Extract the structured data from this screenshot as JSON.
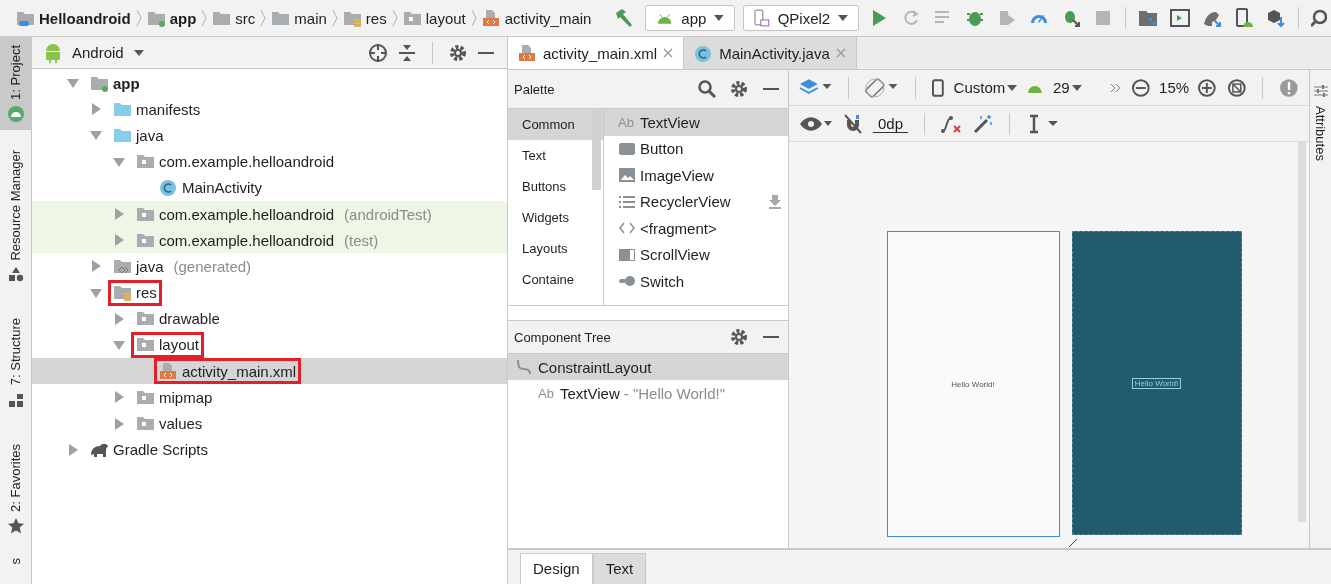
{
  "breadcrumb": [
    {
      "label": "Helloandroid",
      "kind": "project"
    },
    {
      "label": "app",
      "kind": "module"
    },
    {
      "label": "src",
      "kind": "folder"
    },
    {
      "label": "main",
      "kind": "folder"
    },
    {
      "label": "res",
      "kind": "res"
    },
    {
      "label": "layout",
      "kind": "package"
    },
    {
      "label": "activity_main",
      "kind": "xml"
    }
  ],
  "run_config": {
    "label": "app"
  },
  "device": {
    "label": "QPixel2"
  },
  "toolbar": [
    {
      "kind": "run",
      "disabled": false
    },
    {
      "kind": "apply-changes",
      "disabled": true
    },
    {
      "kind": "apply-code",
      "disabled": true
    },
    {
      "kind": "debug",
      "disabled": false
    },
    {
      "kind": "profile-run",
      "disabled": true
    },
    {
      "kind": "profiler",
      "disabled": false
    },
    {
      "kind": "attach",
      "disabled": false
    },
    {
      "kind": "stop",
      "disabled": true
    }
  ],
  "left_tabs": [
    {
      "label": "1: Project",
      "selected": true,
      "kind": "android"
    },
    {
      "label": "Resource Manager",
      "selected": false,
      "kind": "shapes"
    },
    {
      "label": "7: Structure",
      "selected": false,
      "kind": "structure"
    },
    {
      "label": "2: Favorites",
      "selected": false,
      "kind": "star"
    },
    {
      "label": "s",
      "selected": false,
      "kind": "none"
    }
  ],
  "project": {
    "view": "Android",
    "tree": [
      {
        "label": "app",
        "kind": "module",
        "expanded": true,
        "selected": false,
        "children": [
          {
            "label": "manifests",
            "kind": "src-folder",
            "expanded": false,
            "selected": false
          },
          {
            "label": "java",
            "kind": "src-folder",
            "expanded": true,
            "selected": false,
            "children": [
              {
                "label": "com.example.helloandroid",
                "kind": "package",
                "expanded": true,
                "selected": false,
                "children": [
                  {
                    "label": "MainActivity",
                    "kind": "class",
                    "selected": false
                  }
                ]
              },
              {
                "label": "com.example.helloandroid",
                "suffix": "(androidTest)",
                "kind": "package",
                "expanded": false,
                "selected": false,
                "tinted": true
              },
              {
                "label": "com.example.helloandroid",
                "suffix": "(test)",
                "kind": "package",
                "expanded": false,
                "selected": false,
                "tinted": true
              }
            ]
          },
          {
            "label": "java",
            "suffix": "(generated)",
            "kind": "generated-folder",
            "expanded": false,
            "selected": false
          },
          {
            "label": "res",
            "kind": "res-folder",
            "expanded": true,
            "selected": false,
            "highlighted": true,
            "children": [
              {
                "label": "drawable",
                "kind": "package",
                "expanded": false,
                "selected": false
              },
              {
                "label": "layout",
                "kind": "package",
                "expanded": true,
                "selected": false,
                "highlighted": true,
                "children": [
                  {
                    "label": "activity_main.xml",
                    "kind": "xml",
                    "selected": true,
                    "highlighted": true
                  }
                ]
              },
              {
                "label": "mipmap",
                "kind": "package",
                "expanded": false,
                "selected": false
              },
              {
                "label": "values",
                "kind": "package",
                "expanded": false,
                "selected": false
              }
            ]
          }
        ]
      },
      {
        "label": "Gradle Scripts",
        "kind": "gradle",
        "expanded": false,
        "selected": false
      }
    ]
  },
  "editor_tabs": [
    {
      "label": "activity_main.xml",
      "kind": "xml",
      "selected": true
    },
    {
      "label": "MainActivity.java",
      "kind": "class",
      "selected": false
    }
  ],
  "palette": {
    "title": "Palette",
    "categories": [
      {
        "label": "Common",
        "selected": true
      },
      {
        "label": "Text",
        "selected": false
      },
      {
        "label": "Buttons",
        "selected": false
      },
      {
        "label": "Widgets",
        "selected": false
      },
      {
        "label": "Layouts",
        "selected": false
      },
      {
        "label": "Containe",
        "selected": false
      }
    ],
    "items": [
      {
        "label": "TextView",
        "kind": "text",
        "glyph": "Ab",
        "selected": true
      },
      {
        "label": "Button",
        "kind": "button",
        "selected": false
      },
      {
        "label": "ImageView",
        "kind": "image",
        "selected": false
      },
      {
        "label": "RecyclerView",
        "kind": "list",
        "selected": false,
        "downloadable": true
      },
      {
        "label": "<fragment>",
        "kind": "fragment",
        "selected": false
      },
      {
        "label": "ScrollView",
        "kind": "scroll",
        "selected": false
      },
      {
        "label": "Switch",
        "kind": "switch",
        "selected": false
      }
    ]
  },
  "component_tree": {
    "title": "Component Tree",
    "nodes": [
      {
        "label": "ConstraintLayout",
        "kind": "layout",
        "selected": true,
        "children": [
          {
            "label": "TextView",
            "detail": "- \"Hello World!\"",
            "kind": "text",
            "glyph": "Ab",
            "selected": false
          }
        ]
      }
    ]
  },
  "design_toolbar": {
    "device": "Custom",
    "api": "29",
    "zoom": "15%",
    "margin": "0dp"
  },
  "design_preview": {
    "text": "Hello World!"
  },
  "blueprint_preview": {
    "text": "Hello World!"
  },
  "bottom_tabs": [
    {
      "label": "Design",
      "selected": true
    },
    {
      "label": "Text",
      "selected": false
    }
  ],
  "right_tab": {
    "label": "Attributes"
  }
}
